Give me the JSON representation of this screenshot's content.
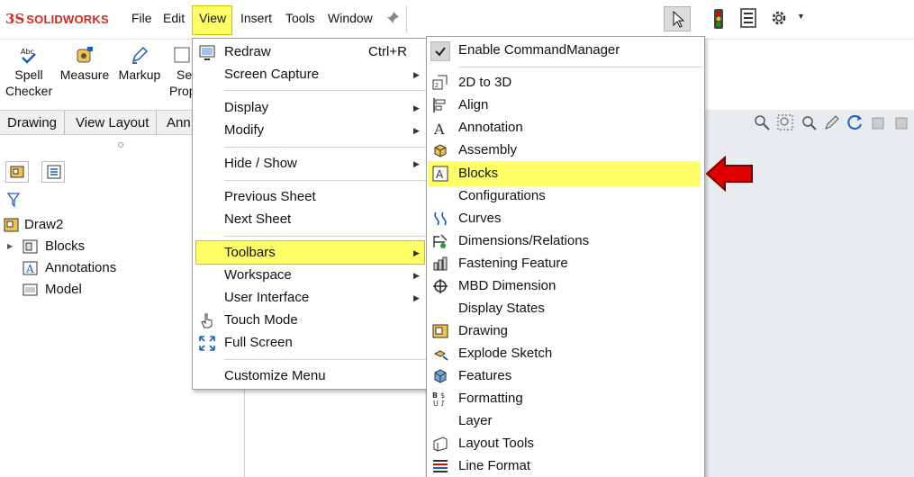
{
  "app": {
    "logo_ds": "3S",
    "logo_text": "SOLIDWORKS"
  },
  "menubar": {
    "items": [
      "File",
      "Edit",
      "View",
      "Insert",
      "Tools",
      "Window"
    ]
  },
  "command_manager": {
    "buttons": [
      {
        "line1": "Spell",
        "line2": "Checker"
      },
      {
        "line1": "Measure",
        "line2": ""
      },
      {
        "line1": "Markup",
        "line2": ""
      },
      {
        "line1": "Se",
        "line2": "Prop"
      }
    ]
  },
  "tabs": [
    "Drawing",
    "View Layout",
    "Ann"
  ],
  "feature_tree": {
    "root": "Draw2",
    "children": [
      "Blocks",
      "Annotations",
      "Model"
    ]
  },
  "view_menu": {
    "items": [
      {
        "label": "Redraw",
        "shortcut": "Ctrl+R",
        "submenu": false
      },
      {
        "label": "Screen Capture",
        "shortcut": "",
        "submenu": true
      },
      {
        "label": "Display",
        "shortcut": "",
        "submenu": true
      },
      {
        "label": "Modify",
        "shortcut": "",
        "submenu": true
      },
      {
        "label": "Hide / Show",
        "shortcut": "",
        "submenu": true
      },
      {
        "label": "Previous Sheet",
        "shortcut": "",
        "submenu": false
      },
      {
        "label": "Next Sheet",
        "shortcut": "",
        "submenu": false
      },
      {
        "label": "Toolbars",
        "shortcut": "",
        "submenu": true
      },
      {
        "label": "Workspace",
        "shortcut": "",
        "submenu": true
      },
      {
        "label": "User Interface",
        "shortcut": "",
        "submenu": true
      },
      {
        "label": "Touch Mode",
        "shortcut": "",
        "submenu": false
      },
      {
        "label": "Full Screen",
        "shortcut": "",
        "submenu": false
      },
      {
        "label": "Customize Menu",
        "shortcut": "",
        "submenu": false
      }
    ]
  },
  "toolbars_menu": {
    "enable_label": "Enable CommandManager",
    "items": [
      "2D to 3D",
      "Align",
      "Annotation",
      "Assembly",
      "Blocks",
      "Configurations",
      "Curves",
      "Dimensions/Relations",
      "Fastening Feature",
      "MBD Dimension",
      "Display States",
      "Drawing",
      "Explode Sketch",
      "Features",
      "Formatting",
      "Layer",
      "Layout Tools",
      "Line Format"
    ],
    "highlighted": "Blocks"
  },
  "colors": {
    "highlight": "#ffff66",
    "arrow": "#e00000",
    "brand": "#d52b1e"
  }
}
